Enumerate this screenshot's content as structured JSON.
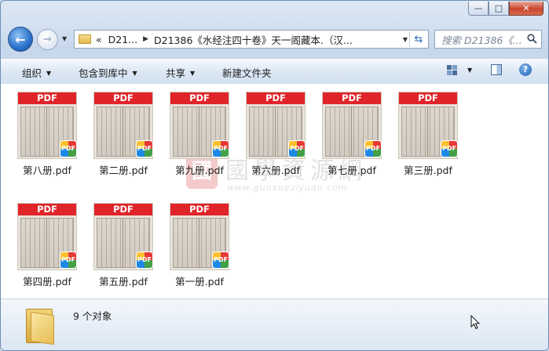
{
  "window": {
    "caption": {
      "minimize": "—",
      "maximize": "□",
      "close": "✕"
    }
  },
  "nav": {
    "back_glyph": "←",
    "forward_glyph": "→",
    "dropdown_glyph": "▼"
  },
  "address": {
    "overflow": "«",
    "crumbs": [
      "D21...",
      "D21386《水经注四十卷》天一阁藏本.（汉..."
    ],
    "separator": "▶",
    "dropdown_glyph": "▼",
    "refresh_glyph": "⇆"
  },
  "search": {
    "placeholder": "搜索 D21386《...",
    "icon": "search-icon"
  },
  "toolbar": {
    "organize": "组织",
    "include_in_library": "包含到库中",
    "share": "共享",
    "new_folder": "新建文件夹",
    "arrow": "▼",
    "help": "?"
  },
  "watermark": {
    "seal": "國",
    "title": "國學資源網",
    "url": "www.guoxueziyuan.com"
  },
  "files": [
    {
      "name": "第八册.pdf",
      "band": "PDF",
      "badge": "PDF"
    },
    {
      "name": "第二册.pdf",
      "band": "PDF",
      "badge": "PDF"
    },
    {
      "name": "第九册.pdf",
      "band": "PDF",
      "badge": "PDF"
    },
    {
      "name": "第六册.pdf",
      "band": "PDF",
      "badge": "PDF"
    },
    {
      "name": "第七册.pdf",
      "band": "PDF",
      "badge": "PDF"
    },
    {
      "name": "第三册.pdf",
      "band": "PDF",
      "badge": "PDF"
    },
    {
      "name": "第四册.pdf",
      "band": "PDF",
      "badge": "PDF"
    },
    {
      "name": "第五册.pdf",
      "band": "PDF",
      "badge": "PDF"
    },
    {
      "name": "第一册.pdf",
      "band": "PDF",
      "badge": "PDF"
    }
  ],
  "status": {
    "item_count": "9 个对象"
  },
  "colors": {
    "pdf_band": "#e0252a",
    "toolbar_bg": "#dde8f5",
    "frame": "#6d8db3"
  }
}
